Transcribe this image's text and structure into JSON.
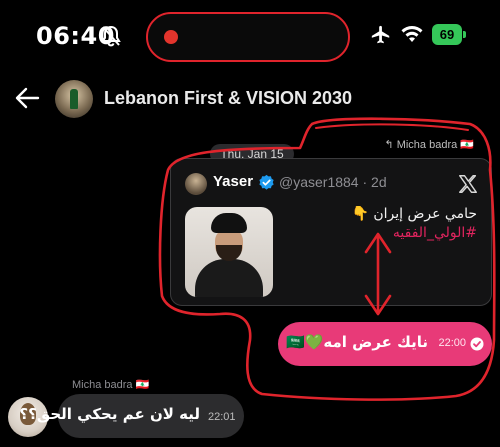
{
  "status_bar": {
    "time": "06:40",
    "battery": "69",
    "icons": [
      "bell-slash-icon",
      "record-dot-icon",
      "airplane-icon",
      "wifi-icon",
      "battery-icon"
    ]
  },
  "header": {
    "title": "Lebanon First & VISION 2030",
    "back_icon": "back-arrow-icon"
  },
  "quoted_sender": "Micha badra 🇱🇧",
  "date_chip": "Thu, Jan 15",
  "tweet": {
    "name": "Yaser",
    "handle": "@yaser1884 · 2d",
    "text": "حامي عرض إيران 👇",
    "hashtag": "#الولي_الفقيه"
  },
  "outgoing_message": {
    "text": "نايك عرض امه💚🇸🇦",
    "time": "22:00"
  },
  "incoming_message": {
    "sender": "Micha badra 🇱🇧",
    "text": "ليه لان عم يحكي الحق؟؟",
    "time": "22:01"
  },
  "colors": {
    "background": "#000000",
    "outgoing_bubble": "#e83a78",
    "incoming_bubble": "#2c2c2e",
    "annotation_red": "#e0242c",
    "hashtag": "#e0245e",
    "battery": "#35c759"
  }
}
